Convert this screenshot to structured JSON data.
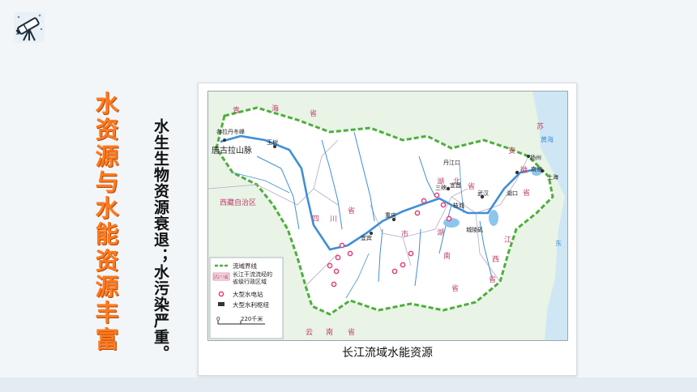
{
  "slide": {
    "title_chars": [
      "水",
      "资",
      "源",
      "与",
      "水",
      "能",
      "资",
      "源",
      "丰",
      "富"
    ],
    "subtitle": "水生生物资源衰退；水污染严重。",
    "caption": "长江流域水能资源"
  },
  "map": {
    "place_labels": {
      "qinghai_1": "青",
      "qinghai_2": "海",
      "qinghai_3": "省",
      "tanggula": "唐古拉山脉",
      "gela": "各拉丹冬峰",
      "xizang": "西藏自治区",
      "yushu": "玉树",
      "sichuan_1": "四",
      "sichuan_2": "川",
      "sichuan_3": "省",
      "yibin": "宜宾",
      "chongqing": "重庆",
      "chongqing_shi": "市",
      "yunnan_1": "云",
      "yunnan_2": "南",
      "yunnan_3": "省",
      "hubei_1": "湖",
      "hubei_2": "北",
      "hubei_3": "省",
      "hunan_1": "湖",
      "hunan_2": "南",
      "hunan_3": "省",
      "jiangxi_1": "江",
      "jiangxi_2": "西",
      "jiangxi_3": "省",
      "anhui_1": "安",
      "anhui_2": "徽",
      "anhui_3": "省",
      "jiangsu_1": "苏",
      "shanghai": "上海",
      "nanjing": "南京",
      "yangzhou": "扬州",
      "wuhan": "武汉",
      "yichang": "宜昌",
      "sanxia": "三峡",
      "zhijiang": "枝城",
      "chenglingji": "城陵矶",
      "danjiangkou": "丹江口",
      "hukou": "湖口",
      "huanghai": "黄海",
      "donghai": "东"
    },
    "legend": {
      "boundary": "流域界线",
      "province_tag": "四川省",
      "province_desc_1": "长江干流流经的",
      "province_desc_2": "省级行政区域",
      "hydro": "大型水电站",
      "hub": "大型水利枢纽",
      "scale_zero": "0",
      "scale_len": "220千米"
    }
  }
}
